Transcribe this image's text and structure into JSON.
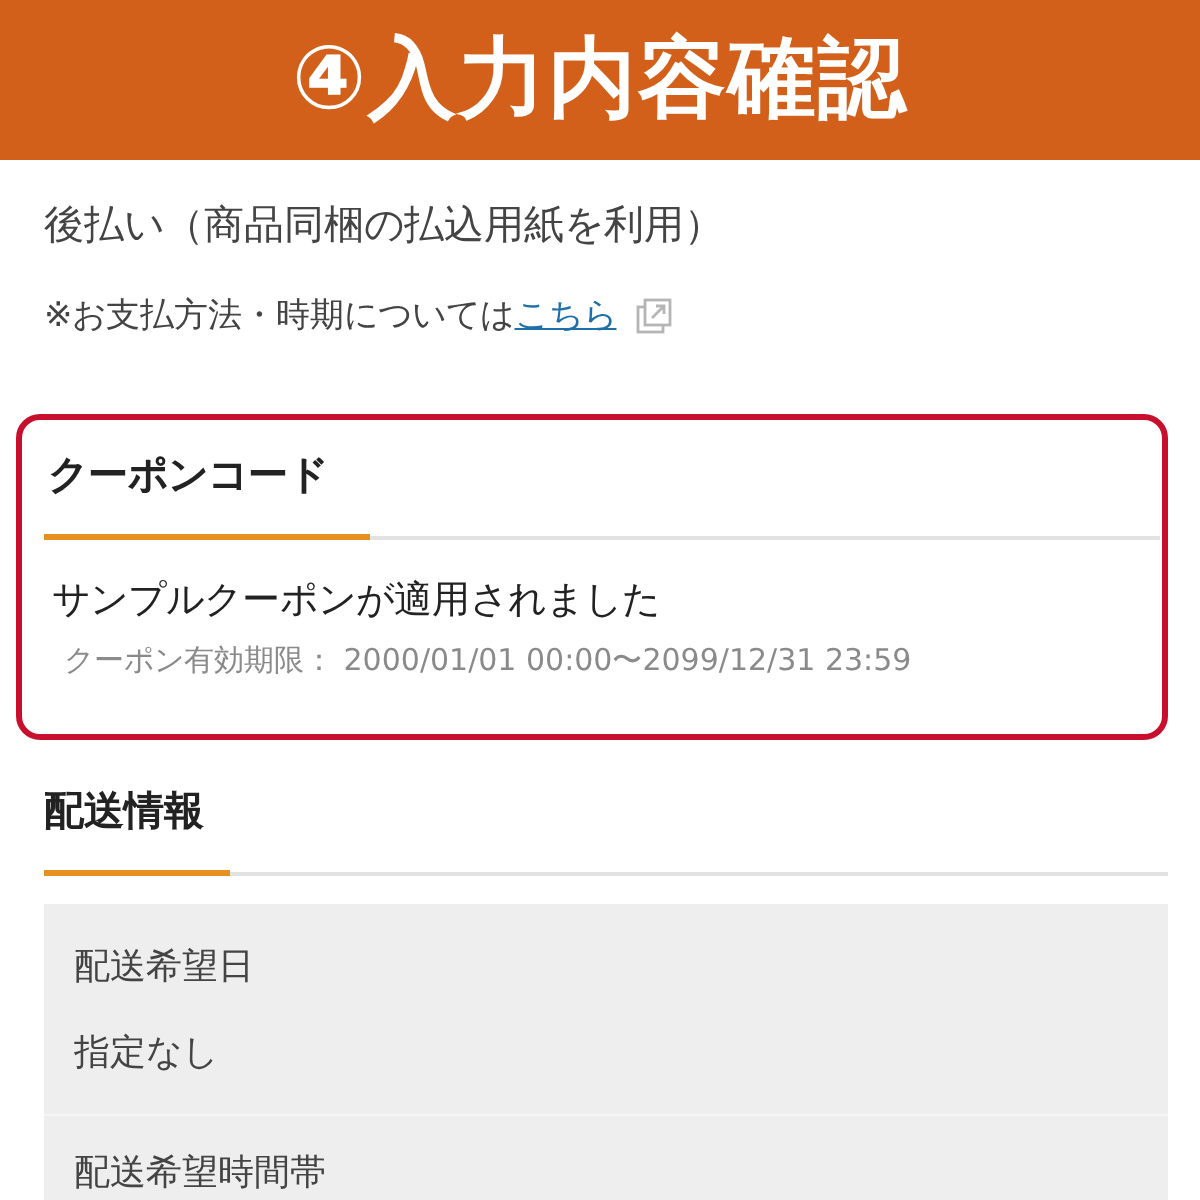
{
  "banner": {
    "title": "④入力内容確認"
  },
  "payment": {
    "method": "後払い（商品同梱の払込用紙を利用）",
    "note": "※お支払方法・時期については",
    "link": "こちら"
  },
  "coupon": {
    "highlighted": true,
    "title": "クーポンコード",
    "message": "サンプルクーポンが適用されました",
    "validity": "クーポン有効期限： 2000/01/01 00:00〜2099/12/31 23:59"
  },
  "delivery": {
    "title": "配送情報",
    "fields": [
      {
        "label": "配送希望日",
        "value": "指定なし"
      },
      {
        "label": "配送希望時間帯"
      }
    ]
  }
}
